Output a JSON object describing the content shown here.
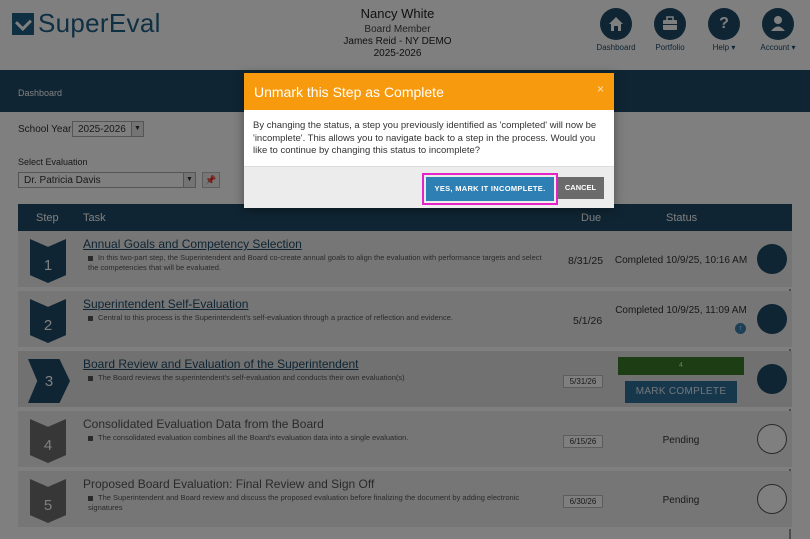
{
  "app": {
    "logo_text": "SuperEval"
  },
  "user": {
    "name": "Nancy White",
    "role": "Board Member",
    "org": "James Reid - NY DEMO",
    "year": "2025-2026"
  },
  "nav": [
    {
      "label": "Dashboard",
      "icon": "home-icon"
    },
    {
      "label": "Portfolio",
      "icon": "briefcase-icon"
    },
    {
      "label": "Help ▾",
      "icon": "question-icon"
    },
    {
      "label": "Account ▾",
      "icon": "person-icon"
    }
  ],
  "breadcrumb": "Dashboard",
  "filters": {
    "school_year_label": "School Year:",
    "school_year_value": "2025-2026",
    "evaluation_label": "Select Evaluation",
    "evaluation_value": "Dr. Patricia Davis"
  },
  "table": {
    "headers": {
      "step": "Step",
      "task": "Task",
      "due": "Due",
      "status": "Status"
    },
    "rows": [
      {
        "step": "1",
        "title": "Annual Goals and Competency Selection",
        "desc": "In this two-part step, the Superintendent and Board co-create annual goals to align the evaluation with performance targets and select the competencies that will be evaluated.",
        "due": "8/31/25",
        "status": "Completed 10/9/25, 10:16 AM"
      },
      {
        "step": "2",
        "title": "Superintendent Self-Evaluation",
        "desc": "Central to this process is the Superintendent's self-evaluation through a practice of reflection and evidence.",
        "due": "5/1/26",
        "status": "Completed 10/9/25, 11:09 AM"
      },
      {
        "step": "3",
        "title": "Board Review and Evaluation of the Superintendent",
        "desc": "The Board reviews the superintendent's self-evaluation and conducts their own evaluation(s)",
        "due": "5/31/26",
        "status_bar": "4",
        "action": "MARK COMPLETE"
      },
      {
        "step": "4",
        "title": "Consolidated Evaluation Data from the Board",
        "desc": "The consolidated evaluation combines all the Board's evaluation data into a single evaluation.",
        "due": "6/15/26",
        "status": "Pending"
      },
      {
        "step": "5",
        "title": "Proposed Board Evaluation: Final Review and Sign Off",
        "desc": "The Superintendent and Board review and discuss the proposed evaluation before finalizing the document by adding electronic signatures",
        "due": "6/30/26",
        "status": "Pending"
      }
    ]
  },
  "modal": {
    "title": "Unmark this Step as Complete",
    "close": "×",
    "body": "By changing the status, a step you previously identified as 'completed' will now be 'incomplete'. This allows you to navigate back to a step in the process. Would you like to continue by changing this status to incomplete?",
    "confirm": "YES, MARK IT INCOMPLETE.",
    "cancel": "CANCEL"
  },
  "colors": {
    "brand": "#1e4a66",
    "modal_header": "#f79a0e",
    "confirm": "#2e7fb3",
    "highlight": "#e524c8",
    "progress": "#3b7a2a"
  }
}
